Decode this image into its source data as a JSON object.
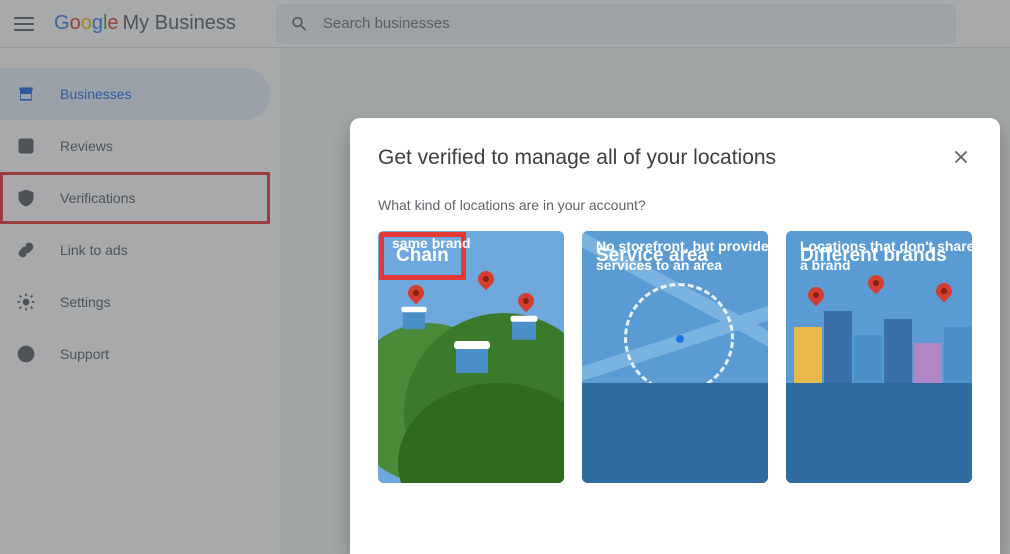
{
  "header": {
    "logo_text": "Google",
    "product_name": "My Business",
    "search_placeholder": "Search businesses"
  },
  "sidebar": {
    "items": [
      {
        "id": "businesses",
        "label": "Businesses",
        "icon": "storefront-icon",
        "active": true
      },
      {
        "id": "reviews",
        "label": "Reviews",
        "icon": "edit-square-icon",
        "active": false
      },
      {
        "id": "verifications",
        "label": "Verifications",
        "icon": "shield-check-icon",
        "active": false,
        "highlighted": true
      },
      {
        "id": "link-to-ads",
        "label": "Link to ads",
        "icon": "link-icon",
        "active": false
      },
      {
        "id": "settings",
        "label": "Settings",
        "icon": "gear-icon",
        "active": false
      },
      {
        "id": "support",
        "label": "Support",
        "icon": "help-icon",
        "active": false
      }
    ]
  },
  "modal": {
    "title": "Get verified to manage all of your locations",
    "subtitle": "What kind of locations are in your account?",
    "cards": [
      {
        "id": "chain",
        "title": "Chain",
        "description": "Storefront locations of the same brand",
        "highlighted_title": true
      },
      {
        "id": "service-area",
        "title": "Service area",
        "description": "No storefront, but provide services to an area"
      },
      {
        "id": "different-brands",
        "title": "Different brands",
        "description": "Locations that don't share a brand"
      }
    ]
  },
  "colors": {
    "accent": "#1a73e8",
    "highlight": "#e53935"
  }
}
